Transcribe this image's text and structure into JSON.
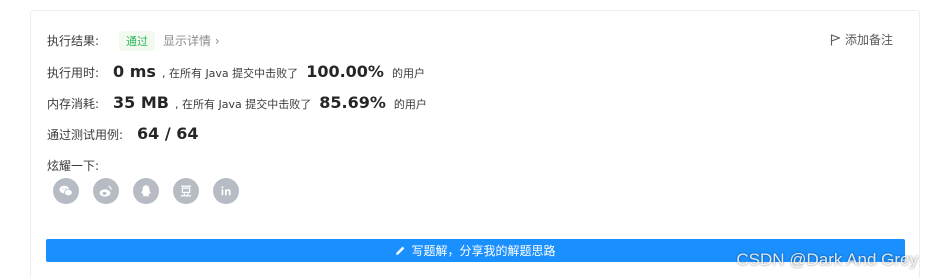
{
  "result": {
    "label": "执行结果:",
    "status": "通过",
    "details_link": "显示详情 ›",
    "add_note": "添加备注"
  },
  "runtime": {
    "label": "执行用时:",
    "value": "0 ms",
    "middle": ", 在所有 Java 提交中击败了",
    "percent": "100.00%",
    "suffix": "的用户"
  },
  "memory": {
    "label": "内存消耗:",
    "value": "35 MB",
    "middle": ", 在所有 Java 提交中击败了",
    "percent": "85.69%",
    "suffix": "的用户"
  },
  "tests": {
    "label": "通过测试用例:",
    "value": "64 / 64"
  },
  "share": {
    "label": "炫耀一下:",
    "icons": [
      "wechat-icon",
      "weibo-icon",
      "qq-icon",
      "douban-icon",
      "linkedin-icon"
    ]
  },
  "solution_button": "写题解，分享我的解题思路",
  "watermark": "CSDN @Dark And Grey",
  "colors": {
    "accent": "#1a90ff",
    "pass_green": "#2db55d",
    "share_gray": "#b7bcc4"
  }
}
